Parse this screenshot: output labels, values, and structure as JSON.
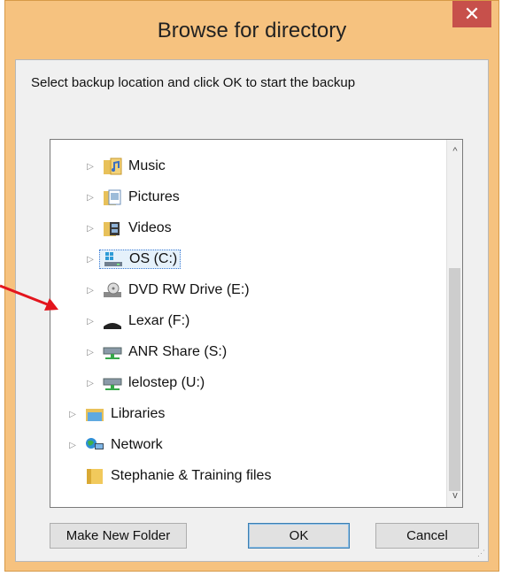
{
  "window": {
    "title": "Browse for directory",
    "close_glyph": "✕"
  },
  "instruction": "Select backup location and click OK to start the backup",
  "tree": {
    "items": [
      {
        "label": "Music",
        "icon": "music-folder-icon",
        "expander": "▷"
      },
      {
        "label": "Pictures",
        "icon": "pictures-folder-icon",
        "expander": "▷"
      },
      {
        "label": "Videos",
        "icon": "videos-folder-icon",
        "expander": "▷"
      },
      {
        "label": "OS (C:)",
        "icon": "os-drive-icon",
        "expander": "▷",
        "selected": true
      },
      {
        "label": "DVD RW Drive (E:)",
        "icon": "dvd-drive-icon",
        "expander": "▷"
      },
      {
        "label": "Lexar (F:)",
        "icon": "usb-drive-icon",
        "expander": "▷"
      },
      {
        "label": "ANR Share (S:)",
        "icon": "network-drive-icon",
        "expander": "▷"
      },
      {
        "label": "lelostep (U:)",
        "icon": "network-drive-icon",
        "expander": "▷"
      },
      {
        "label": "Libraries",
        "icon": "libraries-icon",
        "expander": "▷"
      },
      {
        "label": "Network",
        "icon": "network-icon",
        "expander": "▷"
      },
      {
        "label": "Stephanie & Training files",
        "icon": "folder-icon",
        "expander": ""
      }
    ],
    "scroll_up": "^",
    "scroll_down": "v"
  },
  "buttons": {
    "new_folder": "Make New Folder",
    "ok": "OK",
    "cancel": "Cancel"
  },
  "colors": {
    "frame": "#f6c27f",
    "close": "#c7504b",
    "annotation_arrow": "#e3151d"
  }
}
